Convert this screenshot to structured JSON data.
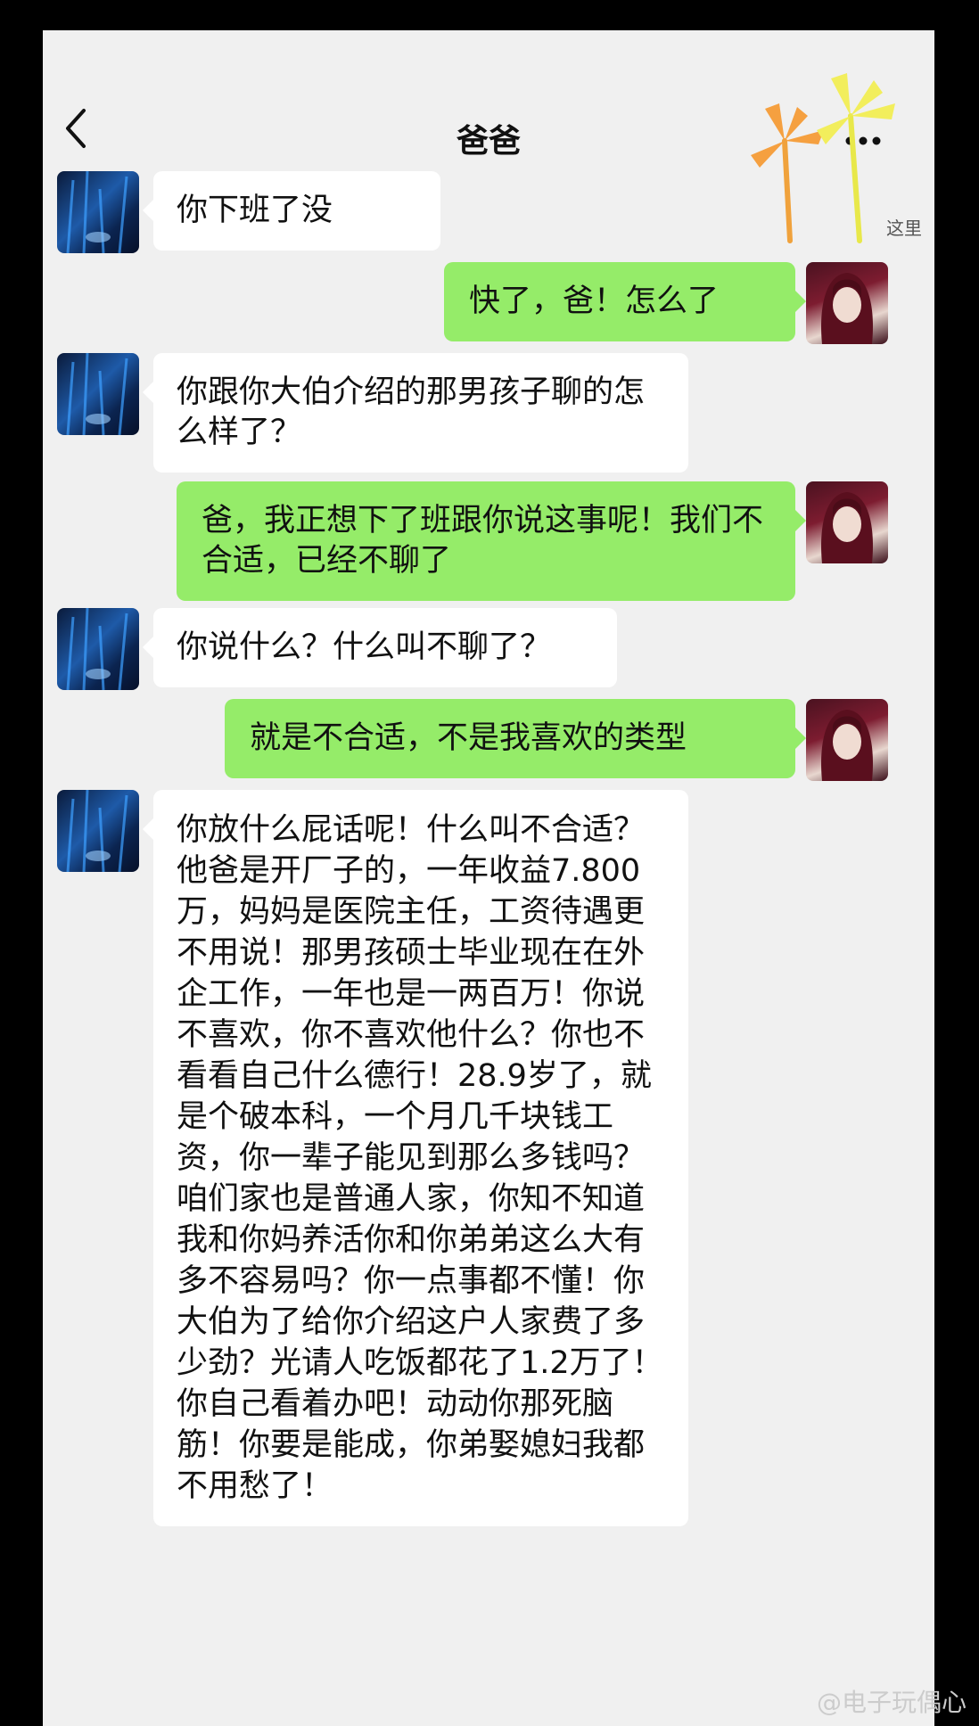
{
  "header": {
    "title": "爸爸",
    "back_icon": "chevron-left-icon",
    "more_icon": "more-horizontal-icon"
  },
  "decoration": {
    "corner_text": "这里"
  },
  "messages": [
    {
      "sender": "dad",
      "text": "你下班了没"
    },
    {
      "sender": "me",
      "text": "快了，爸！怎么了"
    },
    {
      "sender": "dad",
      "text": "你跟你大伯介绍的那男孩子聊的怎么样了？"
    },
    {
      "sender": "me",
      "text": "爸，我正想下了班跟你说这事呢！我们不合适，已经不聊了"
    },
    {
      "sender": "dad",
      "text": "你说什么？什么叫不聊了？"
    },
    {
      "sender": "me",
      "text": "就是不合适，不是我喜欢的类型"
    },
    {
      "sender": "dad",
      "text": "你放什么屁话呢！什么叫不合适？他爸是开厂子的，一年收益7.800万，妈妈是医院主任，工资待遇更不用说！那男孩硕士毕业现在在外企工作，一年也是一两百万！你说不喜欢，你不喜欢他什么？你也不看看自己什么德行！28.9岁了，就是个破本科，一个月几千块钱工资，你一辈子能见到那么多钱吗？咱们家也是普通人家，你知不知道我和你妈养活你和你弟弟这么大有多不容易吗？你一点事都不懂！你大伯为了给你介绍这户人家费了多少劲？光请人吃饭都花了1.2万了！你自己看着办吧！动动你那死脑筋！你要是能成，你弟娶媳妇我都不用愁了！"
    }
  ],
  "footer": {
    "watermark": "@电子玩偶心"
  },
  "colors": {
    "background": "#f0f0f0",
    "bubble_me": "#95ec69",
    "bubble_dad": "#ffffff",
    "frame": "#000000"
  }
}
